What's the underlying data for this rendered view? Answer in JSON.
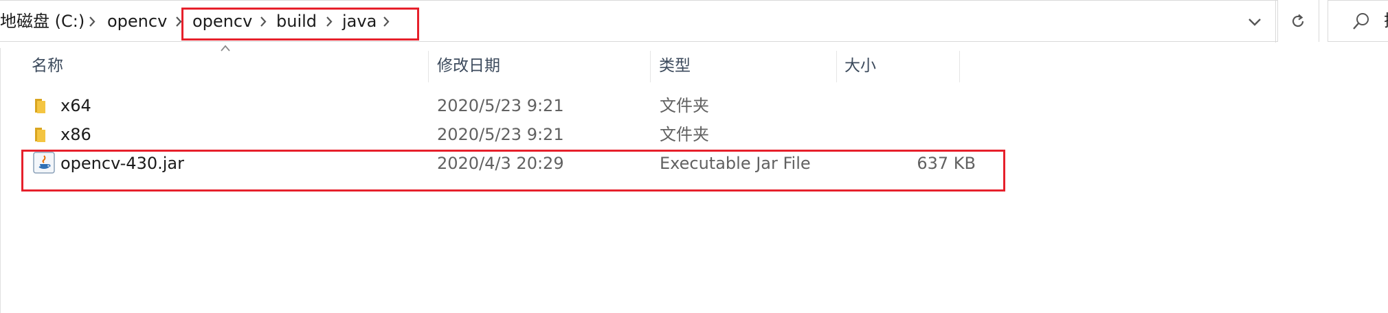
{
  "address_bar": {
    "breadcrumbs": [
      "地磁盘 (C:)",
      "opencv",
      "opencv",
      "build",
      "java"
    ]
  },
  "search": {
    "cut_text": "搜"
  },
  "columns": {
    "name": "名称",
    "date": "修改日期",
    "type": "类型",
    "size": "大小"
  },
  "files": [
    {
      "name": "x64",
      "date": "2020/5/23 9:21",
      "type": "文件夹",
      "size": "",
      "icon": "folder-icon"
    },
    {
      "name": "x86",
      "date": "2020/5/23 9:21",
      "type": "文件夹",
      "size": "",
      "icon": "folder-icon"
    },
    {
      "name": "opencv-430.jar",
      "date": "2020/4/3 20:29",
      "type": "Executable Jar File",
      "size": "637 KB",
      "icon": "java-jar-icon"
    }
  ],
  "colors": {
    "highlight": "#e6202b",
    "folder": "#f4c542",
    "header_text": "#3c4a5c"
  }
}
